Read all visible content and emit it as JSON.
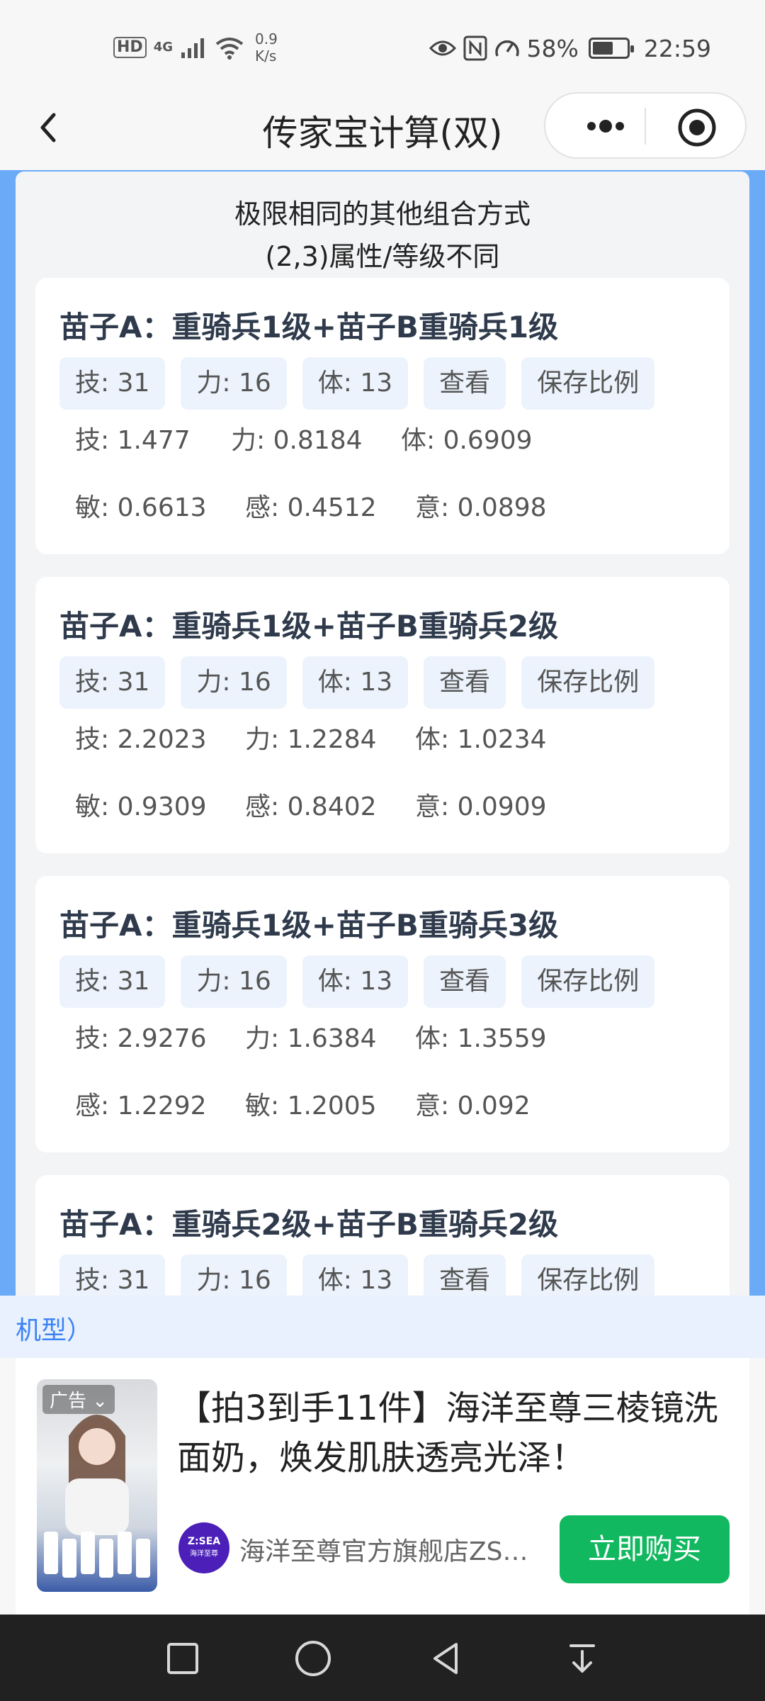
{
  "status_bar": {
    "hd": "HD",
    "network_type": "4G",
    "speed_value": "0.9",
    "speed_unit": "K/s",
    "battery": "58%",
    "time": "22:59"
  },
  "nav": {
    "title": "传家宝计算(双)",
    "back_icon": "chevron-left-icon",
    "more_icon": "more-dots-icon",
    "close_icon": "target-circle-icon"
  },
  "heading": {
    "line1": "极限相同的其他组合方式",
    "line2": "(2,3)属性/等级不同"
  },
  "cards": [
    {
      "title": "苗子A：重骑兵1级+苗子B重骑兵1级",
      "tags": [
        "技: 31",
        "力: 16",
        "体: 13",
        "查看",
        "保存比例"
      ],
      "row1": [
        "技: 1.477",
        "力: 0.8184",
        "体: 0.6909"
      ],
      "row2": [
        "敏: 0.6613",
        "感: 0.4512",
        "意: 0.0898"
      ]
    },
    {
      "title": "苗子A：重骑兵1级+苗子B重骑兵2级",
      "tags": [
        "技: 31",
        "力: 16",
        "体: 13",
        "查看",
        "保存比例"
      ],
      "row1": [
        "技: 2.2023",
        "力: 1.2284",
        "体: 1.0234"
      ],
      "row2": [
        "敏: 0.9309",
        "感: 0.8402",
        "意: 0.0909"
      ]
    },
    {
      "title": "苗子A：重骑兵1级+苗子B重骑兵3级",
      "tags": [
        "技: 31",
        "力: 16",
        "体: 13",
        "查看",
        "保存比例"
      ],
      "row1": [
        "技: 2.9276",
        "力: 1.6384",
        "体: 1.3559"
      ],
      "row2": [
        "感: 1.2292",
        "敏: 1.2005",
        "意: 0.092"
      ]
    },
    {
      "title": "苗子A：重骑兵2级+苗子B重骑兵2级",
      "tags": [
        "技: 31",
        "力: 16",
        "体: 13",
        "查看",
        "保存比例"
      ]
    }
  ],
  "ad": {
    "strip_text": "机型）",
    "badge": "广告",
    "title": "【拍3到手11件】海洋至尊三棱镜洗面奶，焕发肌肤透亮光泽！",
    "logo_text": "Z:SEA",
    "logo_sub": "海洋至尊",
    "store": "海洋至尊官方旗舰店ZS…",
    "buy_button": "立即购买"
  },
  "system_nav": [
    "square-icon",
    "circle-home-icon",
    "triangle-back-icon",
    "download-arrow-icon"
  ],
  "colors": {
    "accent_blue": "#6aaaf7",
    "tag_bg": "#ecf3fc",
    "buy_green": "#11b85f"
  }
}
